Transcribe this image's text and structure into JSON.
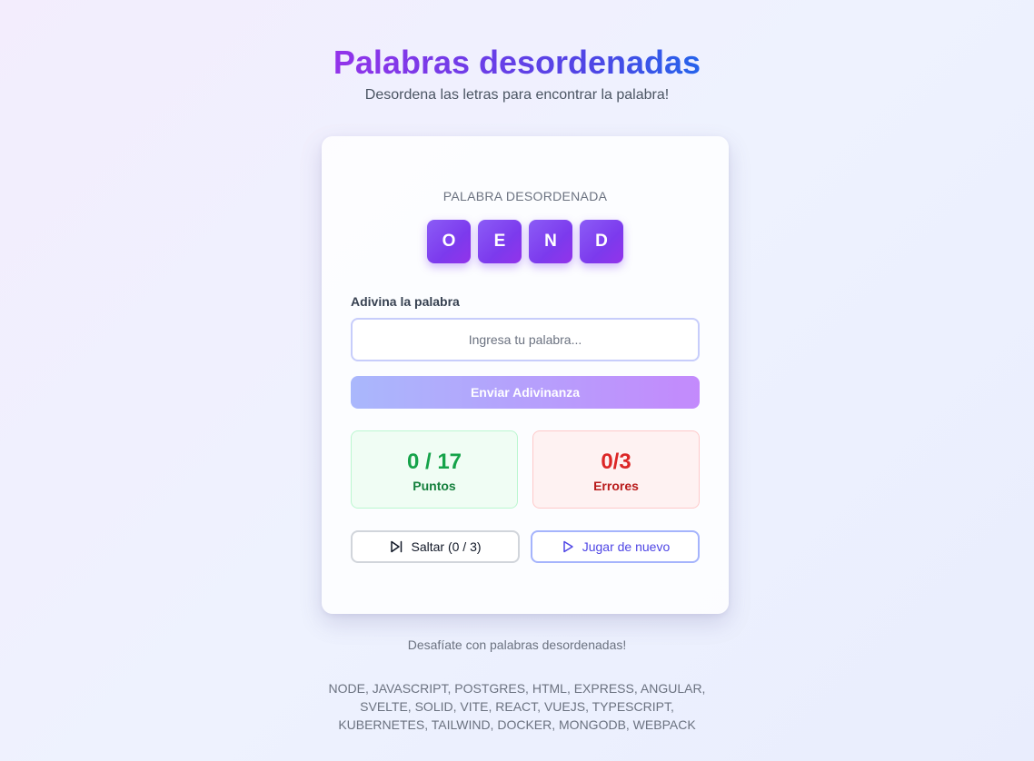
{
  "header": {
    "title": "Palabras desordenadas",
    "subtitle": "Desordena las letras para encontrar la palabra!"
  },
  "game": {
    "scrambled_label": "PALABRA DESORDENADA",
    "letters": [
      "O",
      "E",
      "N",
      "D"
    ],
    "guess_label": "Adivina la palabra",
    "guess_placeholder": "Ingresa tu palabra...",
    "guess_value": "",
    "submit_label": "Enviar Adivinanza",
    "points_value": "0 / 17",
    "points_label": "Puntos",
    "errors_value": "0/3",
    "errors_label": "Errores",
    "skip_label": "Saltar (0 / 3)",
    "replay_label": "Jugar de nuevo"
  },
  "footer": {
    "tagline": "Desafíate con palabras desordenadas!",
    "word_list": "NODE, JAVASCRIPT, POSTGRES, HTML, EXPRESS, ANGULAR, SVELTE, SOLID, VITE, REACT, VUEJS, TYPESCRIPT, KUBERNETES, TAILWIND, DOCKER, MONGODB, WEBPACK"
  },
  "icons": {
    "skip": "skip-forward-icon",
    "replay": "play-icon"
  },
  "colors": {
    "accent": "#7c3aed",
    "points": "#16a34a",
    "errors": "#dc2626",
    "replay": "#4f46e5"
  }
}
